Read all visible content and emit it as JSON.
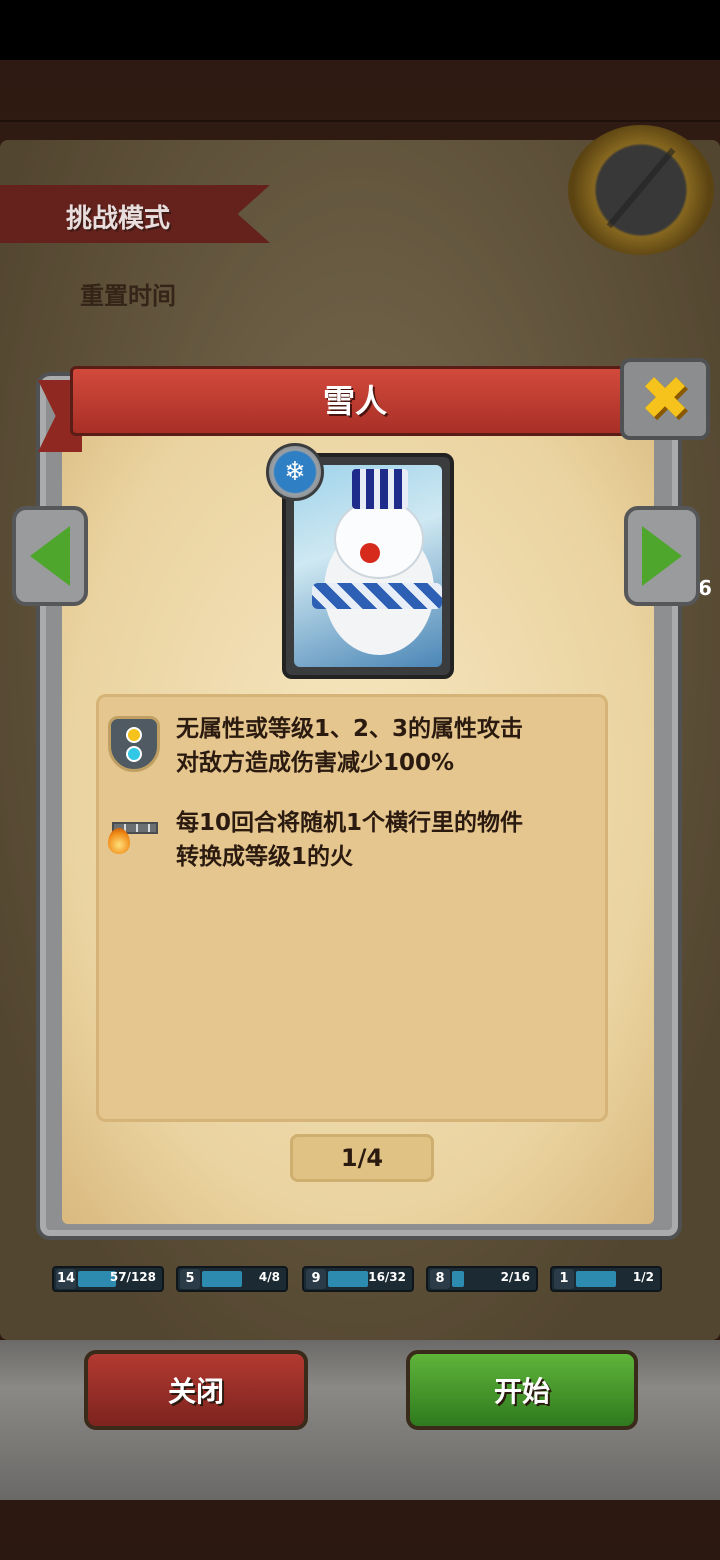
{
  "header": {
    "mode_title": "挑战模式",
    "reset_label": "重置时间"
  },
  "modal": {
    "title": "雪人",
    "card_badge_icon": "snowflake-icon",
    "abilities": [
      {
        "icon": "shield-icon",
        "line1": "无属性或等级1、2、3的属性攻击",
        "line2": "对敌方造成伤害减少100%"
      },
      {
        "icon": "row-fire-icon",
        "line1": "每10回合将随机1个横行里的物件",
        "line2": "转换成等级1的火"
      }
    ],
    "pager": "1/4"
  },
  "right_edge_number": "6",
  "team_stats": [
    {
      "level": "14",
      "progress": "57/128",
      "fill_fraction": 0.45
    },
    {
      "level": "5",
      "progress": "4/8",
      "fill_fraction": 0.5
    },
    {
      "level": "9",
      "progress": "16/32",
      "fill_fraction": 0.5
    },
    {
      "level": "8",
      "progress": "2/16",
      "fill_fraction": 0.125
    },
    {
      "level": "1",
      "progress": "1/2",
      "fill_fraction": 0.5
    }
  ],
  "buttons": {
    "close": "关闭",
    "start": "开始"
  },
  "colors": {
    "ribbon_red": "#c13b2f",
    "start_green": "#4ea62c",
    "close_red": "#a92f26",
    "parchment": "#f0dcae",
    "gold_x": "#f6c21c"
  }
}
